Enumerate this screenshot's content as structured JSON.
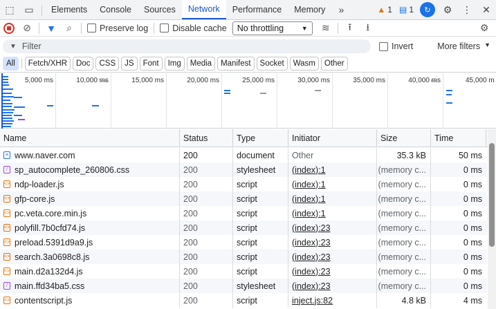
{
  "tabs": [
    "Elements",
    "Console",
    "Sources",
    "Network",
    "Performance",
    "Memory"
  ],
  "active_tab": "Network",
  "badges": {
    "warnings": "1",
    "messages": "1"
  },
  "toolbar": {
    "preserve_log": "Preserve log",
    "disable_cache": "Disable cache",
    "throttling": "No throttling"
  },
  "filter": {
    "placeholder": "Filter",
    "invert": "Invert",
    "more_filters": "More filters"
  },
  "type_filters": [
    "All",
    "Fetch/XHR",
    "Doc",
    "CSS",
    "JS",
    "Font",
    "Img",
    "Media",
    "Manifest",
    "Socket",
    "Wasm",
    "Other"
  ],
  "timeline": {
    "ticks": [
      "5,000 ms",
      "10,000 ms",
      "15,000 ms",
      "20,000 ms",
      "25,000 ms",
      "30,000 ms",
      "35,000 ms",
      "40,000 ms",
      "45,000 m"
    ]
  },
  "columns": [
    "Name",
    "Status",
    "Type",
    "Initiator",
    "Size",
    "Time"
  ],
  "rows": [
    {
      "icon": "doc",
      "name": "www.naver.com",
      "status": "200",
      "type": "document",
      "initiator": "Other",
      "initiator_link": false,
      "size": "35.3 kB",
      "size_grey": false,
      "time": "50 ms"
    },
    {
      "icon": "css",
      "name": "sp_autocomplete_260806.css",
      "status": "200",
      "type": "stylesheet",
      "initiator": "(index):1",
      "initiator_link": true,
      "size": "(memory c...",
      "size_grey": true,
      "time": "0 ms"
    },
    {
      "icon": "js",
      "name": "ndp-loader.js",
      "status": "200",
      "type": "script",
      "initiator": "(index):1",
      "initiator_link": true,
      "size": "(memory c...",
      "size_grey": true,
      "time": "0 ms"
    },
    {
      "icon": "js",
      "name": "gfp-core.js",
      "status": "200",
      "type": "script",
      "initiator": "(index):1",
      "initiator_link": true,
      "size": "(memory c...",
      "size_grey": true,
      "time": "0 ms"
    },
    {
      "icon": "js",
      "name": "pc.veta.core.min.js",
      "status": "200",
      "type": "script",
      "initiator": "(index):1",
      "initiator_link": true,
      "size": "(memory c...",
      "size_grey": true,
      "time": "0 ms"
    },
    {
      "icon": "js",
      "name": "polyfill.7b0cfd74.js",
      "status": "200",
      "type": "script",
      "initiator": "(index):23",
      "initiator_link": true,
      "size": "(memory c...",
      "size_grey": true,
      "time": "0 ms"
    },
    {
      "icon": "js",
      "name": "preload.5391d9a9.js",
      "status": "200",
      "type": "script",
      "initiator": "(index):23",
      "initiator_link": true,
      "size": "(memory c...",
      "size_grey": true,
      "time": "0 ms"
    },
    {
      "icon": "js",
      "name": "search.3a0698c8.js",
      "status": "200",
      "type": "script",
      "initiator": "(index):23",
      "initiator_link": true,
      "size": "(memory c...",
      "size_grey": true,
      "time": "0 ms"
    },
    {
      "icon": "js",
      "name": "main.d2a132d4.js",
      "status": "200",
      "type": "script",
      "initiator": "(index):23",
      "initiator_link": true,
      "size": "(memory c...",
      "size_grey": true,
      "time": "0 ms"
    },
    {
      "icon": "css",
      "name": "main.ffd34ba5.css",
      "status": "200",
      "type": "stylesheet",
      "initiator": "(index):23",
      "initiator_link": true,
      "size": "(memory c...",
      "size_grey": true,
      "time": "0 ms"
    },
    {
      "icon": "js",
      "name": "contentscript.js",
      "status": "200",
      "type": "script",
      "initiator": "inject.js:82",
      "initiator_link": true,
      "size": "4.8 kB",
      "size_grey": false,
      "time": "4 ms"
    }
  ],
  "colors": {
    "accent": "#1a73e8",
    "active_tab": "#1a57c8",
    "chip_active": "#d3e3fd",
    "record": "#d93025"
  }
}
